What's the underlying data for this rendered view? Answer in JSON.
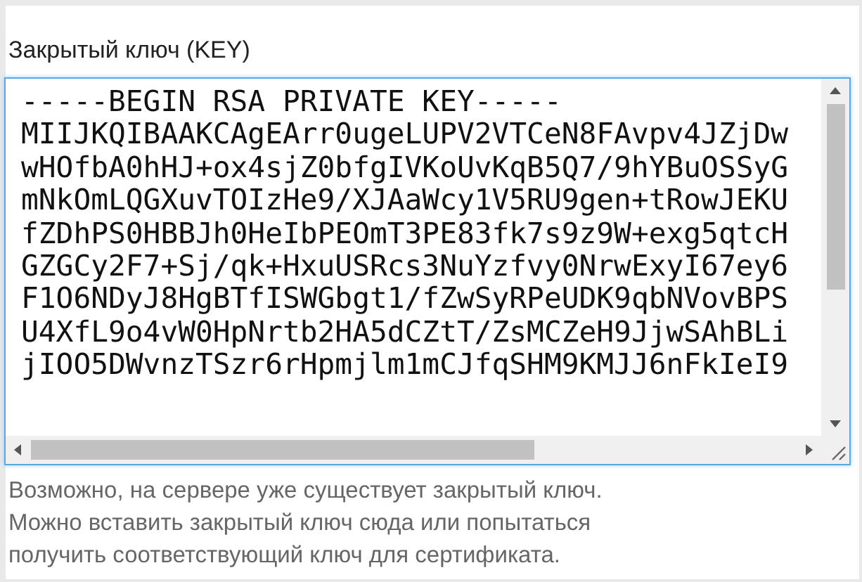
{
  "label": "Закрытый ключ (KEY)",
  "key_field": {
    "lines": [
      "-----BEGIN RSA PRIVATE KEY-----",
      "MIIJKQIBAAKCAgEArr0ugeLUPV2VTCeN8FAvpv4JZjDw",
      "wHOfbA0hHJ+ox4sjZ0bfgIVKoUvKqB5Q7/9hYBuOSSyG",
      "mNkOmLQGXuvTOIzHe9/XJAaWcy1V5RU9gen+tRowJEKU",
      "fZDhPS0HBBJh0HeIbPEOmT3PE83fk7s9z9W+exg5qtcH",
      "GZGCy2F7+Sj/qk+HxuUSRcs3NuYzfvy0NrwExyI67ey6",
      "F1O6NDyJ8HgBTfISWGbgt1/fZwSyRPeUDK9qbNVovBPS",
      "U4XfL9o4vW0HpNrtb2HA5dCZtT/ZsMCZeH9JjwSAhBLi",
      "jIOO5DWvnzTSzr6rHpmjlm1mCJfqSHM9KMJJ6nFkIeI9"
    ]
  },
  "help_text": [
    "Возможно, на сервере уже существует закрытый ключ.",
    "Можно вставить закрытый ключ сюда или попытаться",
    "получить соответствующий ключ для сертификата."
  ]
}
